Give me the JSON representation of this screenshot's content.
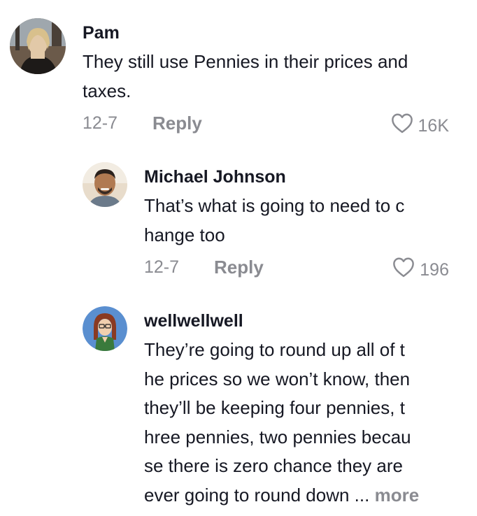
{
  "comments": [
    {
      "author": "Pam",
      "text_lines": [
        "They still use Pennies in their prices and",
        "taxes."
      ],
      "date": "12-7",
      "reply_label": "Reply",
      "likes": "16K"
    },
    {
      "author": "Michael Johnson",
      "text_lines": [
        "That’s what is going to need to c",
        "hange too"
      ],
      "date": "12-7",
      "reply_label": "Reply",
      "likes": "196"
    },
    {
      "author": "wellwellwell",
      "text_lines": [
        "They’re going to round up all of t",
        "he prices so we won’t know, then",
        "they’ll be keeping four pennies, t",
        "hree pennies, two pennies becau",
        "se there is zero chance they are",
        "ever going to round down"
      ],
      "ellipsis": "...",
      "more_label": "more"
    }
  ],
  "colors": {
    "text": "#161823",
    "secondary": "#8a8b91"
  },
  "icons": {
    "like": "heart-outline-icon"
  }
}
